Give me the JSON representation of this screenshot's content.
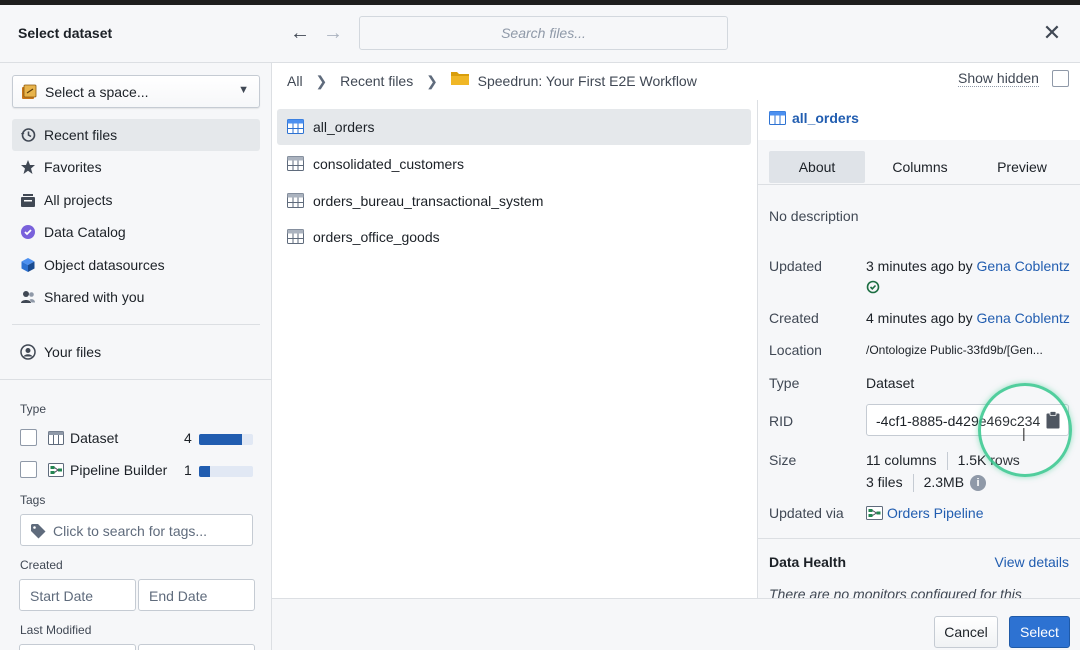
{
  "header": {
    "title": "Select dataset",
    "back_icon": "arrow-left-icon",
    "forward_icon": "arrow-right-icon",
    "search_placeholder": "Search files...",
    "close_icon": "close-icon"
  },
  "sidebar": {
    "space_select": "Select a space...",
    "nav": [
      {
        "label": "Recent files",
        "icon": "history-icon"
      },
      {
        "label": "Favorites",
        "icon": "star-icon"
      },
      {
        "label": "All projects",
        "icon": "projects-icon"
      },
      {
        "label": "Data Catalog",
        "icon": "catalog-icon"
      },
      {
        "label": "Object datasources",
        "icon": "cube-icon"
      },
      {
        "label": "Shared with you",
        "icon": "people-icon"
      }
    ],
    "your_files": "Your files",
    "type_label": "Type",
    "types": [
      {
        "label": "Dataset",
        "count": "4",
        "fraction": 0.8
      },
      {
        "label": "Pipeline Builder",
        "count": "1",
        "fraction": 0.2
      }
    ],
    "tags_label": "Tags",
    "tags_placeholder": "Click to search for tags...",
    "created_label": "Created",
    "start_date": "Start Date",
    "end_date": "End Date",
    "last_modified_label": "Last Modified"
  },
  "breadcrumb": {
    "all": "All",
    "recent": "Recent files",
    "folder": "Speedrun: Your First E2E Workflow",
    "show_hidden": "Show hidden"
  },
  "files": [
    {
      "name": "all_orders",
      "selected": true
    },
    {
      "name": "consolidated_customers"
    },
    {
      "name": "orders_bureau_transactional_system"
    },
    {
      "name": "orders_office_goods"
    }
  ],
  "details": {
    "title": "all_orders",
    "tabs": [
      "About",
      "Columns",
      "Preview"
    ],
    "active_tab": "About",
    "description": "No description",
    "updated_label": "Updated",
    "updated_value": "3 minutes ago by ",
    "updated_user": "Gena Coblentz",
    "created_label": "Created",
    "created_value": "4 minutes ago by ",
    "created_user": "Gena Coblentz",
    "location_label": "Location",
    "location_value": "/Ontologize Public-33fd9b/[Gen...",
    "type_label": "Type",
    "type_value": "Dataset",
    "rid_label": "RID",
    "rid_value": "-4cf1-8885-d429e469c234",
    "size_label": "Size",
    "size_columns": "11 columns",
    "size_rows": "1.5K rows",
    "size_files": "3 files",
    "size_bytes": "2.3MB",
    "updated_via_label": "Updated via",
    "updated_via_value": "Orders Pipeline",
    "health_title": "Data Health",
    "health_link": "View details",
    "health_note": "There are no monitors configured for this"
  },
  "footer": {
    "cancel": "Cancel",
    "select": "Select"
  },
  "colors": {
    "accent": "#2d72d2",
    "link": "#215db0",
    "highlight_ring": "#34c78c"
  }
}
